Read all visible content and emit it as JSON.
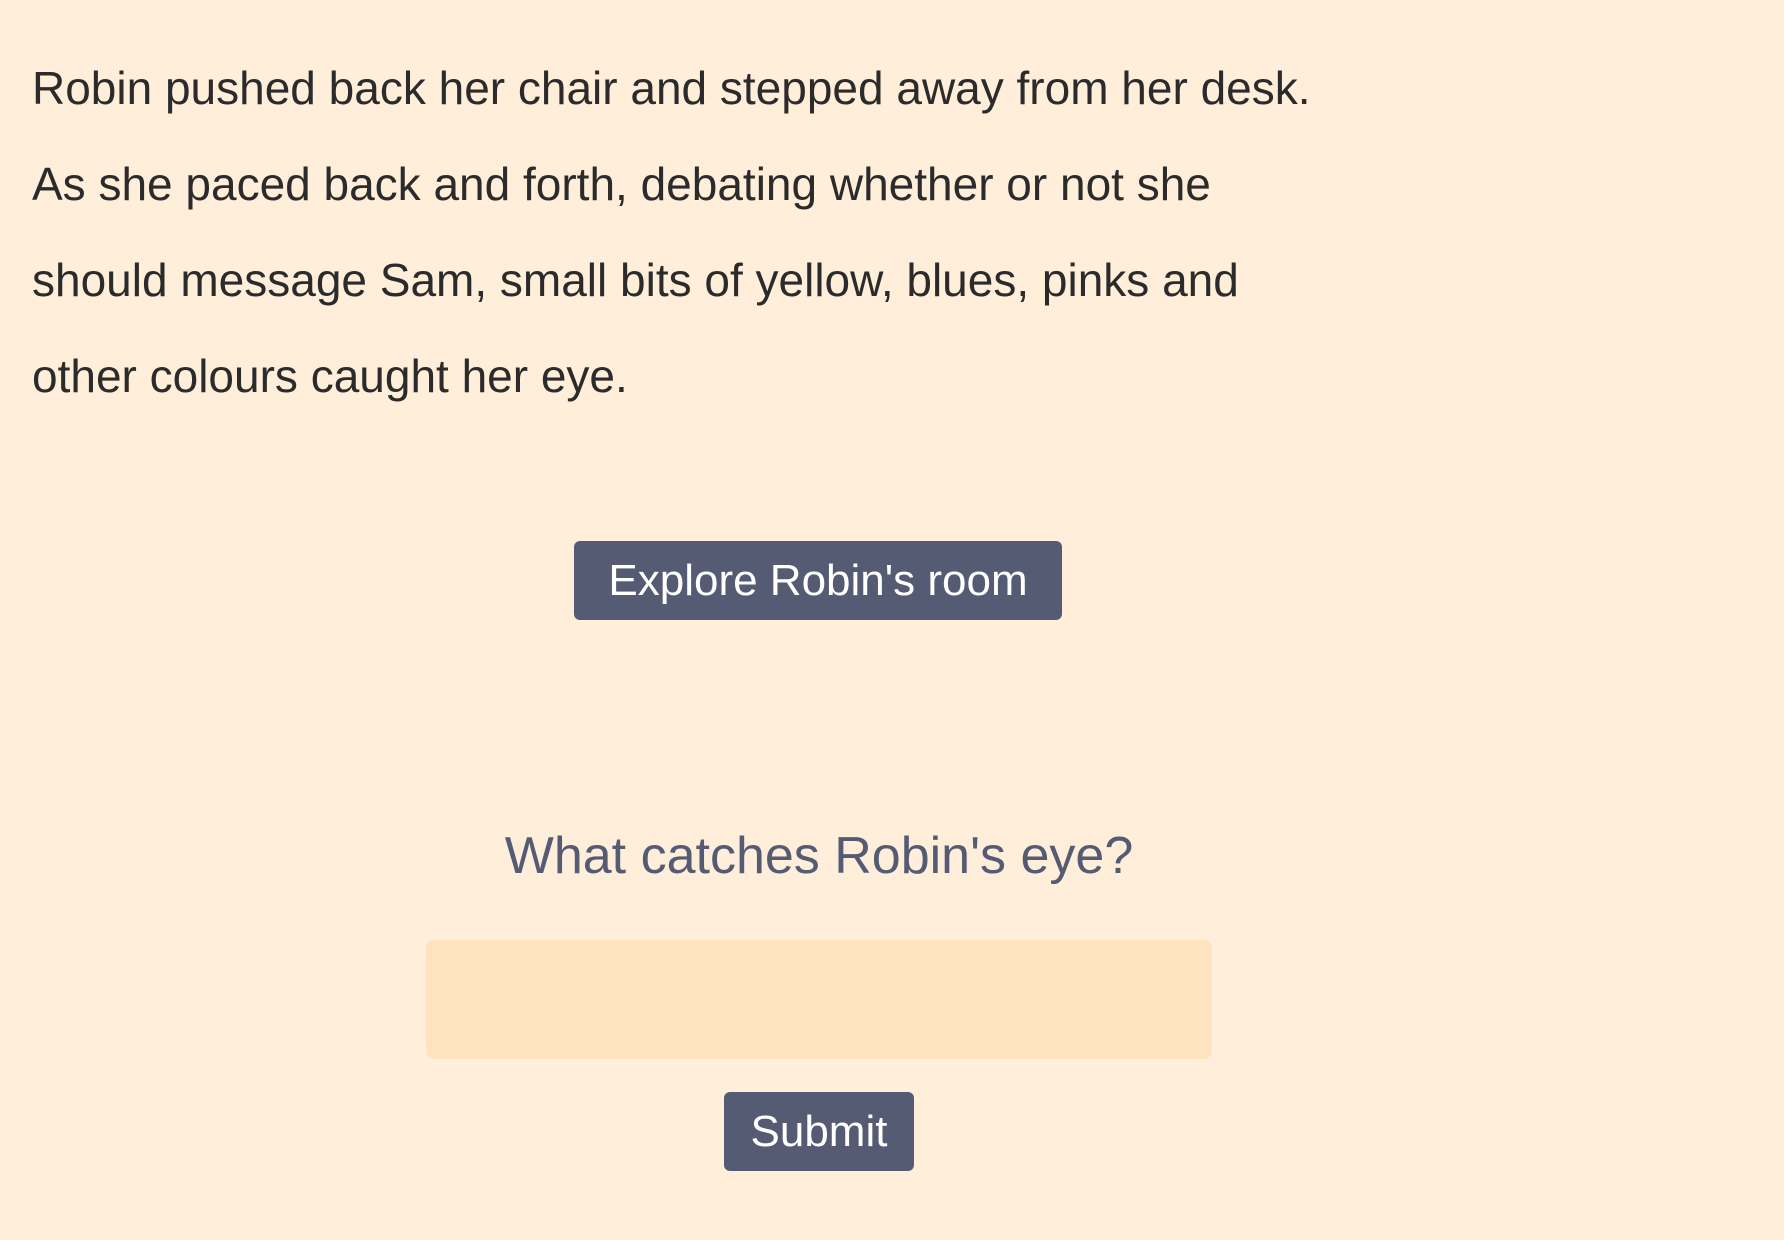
{
  "story": {
    "lines": [
      "Robin pushed back her chair and stepped away from her desk.",
      "As she paced back and forth, debating whether or not she",
      "should message Sam, small bits of yellow, blues, pinks and",
      "other colours caught her eye."
    ]
  },
  "explore_button": {
    "label": "Explore Robin's room"
  },
  "question": {
    "text": "What catches Robin's eye?"
  },
  "answer_input": {
    "value": "",
    "placeholder": ""
  },
  "submit_button": {
    "label": "Submit"
  },
  "colors": {
    "background": "#ffeed9",
    "button": "#555b73",
    "input": "#ffe2c0",
    "question": "#555b73"
  }
}
